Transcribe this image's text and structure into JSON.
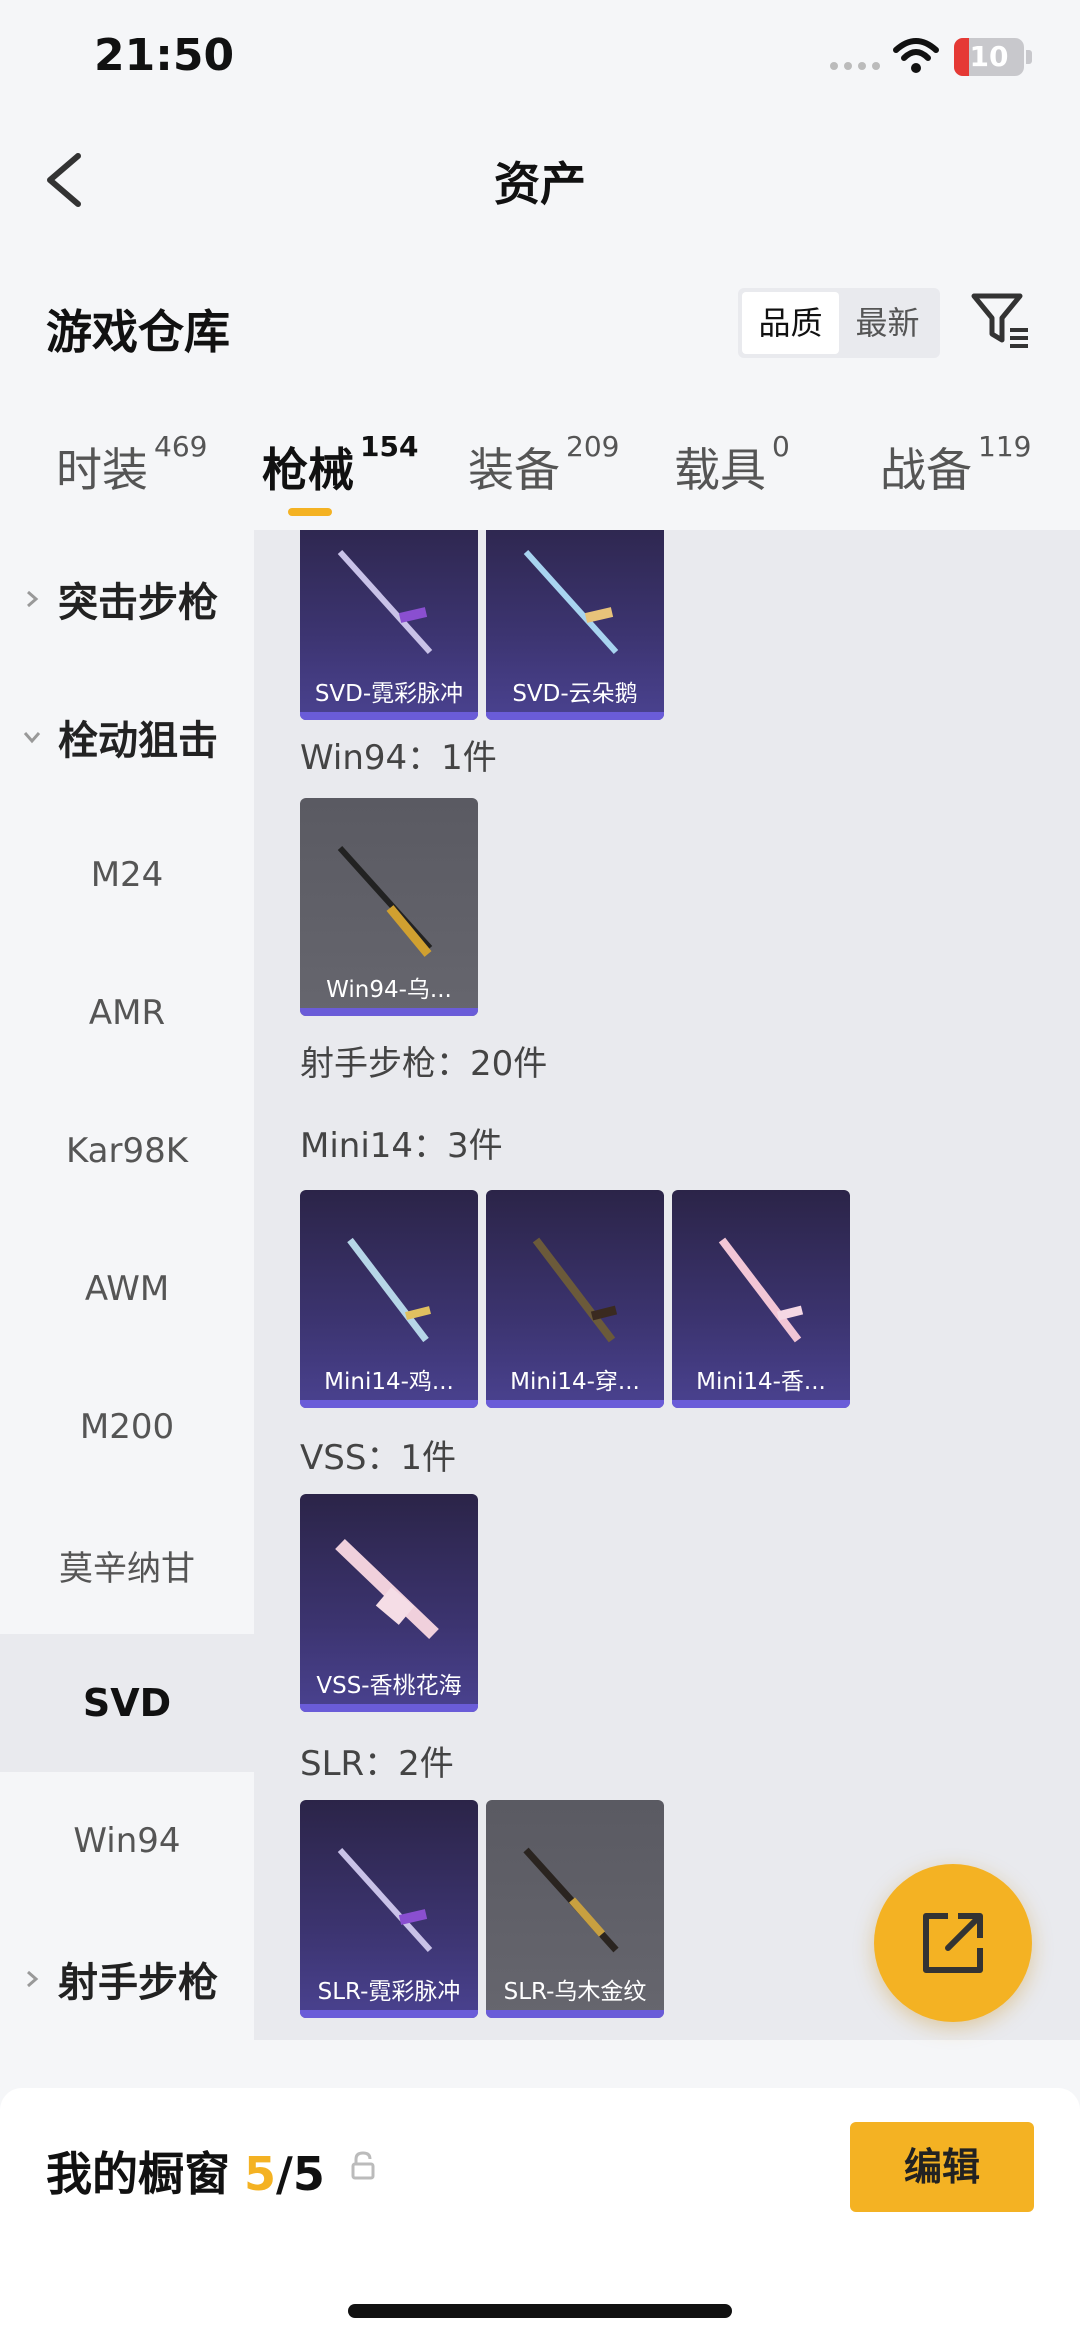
{
  "status": {
    "time": "21:50",
    "battery": "10"
  },
  "header": {
    "title": "资产"
  },
  "warehouse": {
    "title": "游戏仓库",
    "sort_quality": "品质",
    "sort_latest": "最新"
  },
  "tabs": [
    {
      "label": "时装",
      "count": "469"
    },
    {
      "label": "枪械",
      "count": "154"
    },
    {
      "label": "装备",
      "count": "209"
    },
    {
      "label": "载具",
      "count": "0"
    },
    {
      "label": "战备",
      "count": "119"
    }
  ],
  "sidebar": {
    "groups": [
      "突击步枪",
      "栓动狙击",
      "射手步枪"
    ],
    "items": [
      "M24",
      "AMR",
      "Kar98K",
      "AWM",
      "M200",
      "莫辛纳甘",
      "SVD",
      "Win94"
    ]
  },
  "content": {
    "sections": [
      "Win94：1件",
      "射手步枪：20件",
      "Mini14：3件",
      "VSS：1件",
      "SLR：2件"
    ],
    "cards": [
      "SVD-霓彩脉冲",
      "SVD-云朵鹅",
      "Win94-乌...",
      "Mini14-鸡...",
      "Mini14-穿...",
      "Mini14-香...",
      "VSS-香桃花海",
      "SLR-霓彩脉冲",
      "SLR-乌木金纹"
    ]
  },
  "bottom": {
    "showcase_label": "我的橱窗",
    "showcase_current": "5",
    "showcase_total": "/5",
    "edit_label": "编辑"
  },
  "colors": {
    "accent": "#f4b223",
    "card_purple": "#3c3470",
    "card_gray": "#5a5a62"
  }
}
